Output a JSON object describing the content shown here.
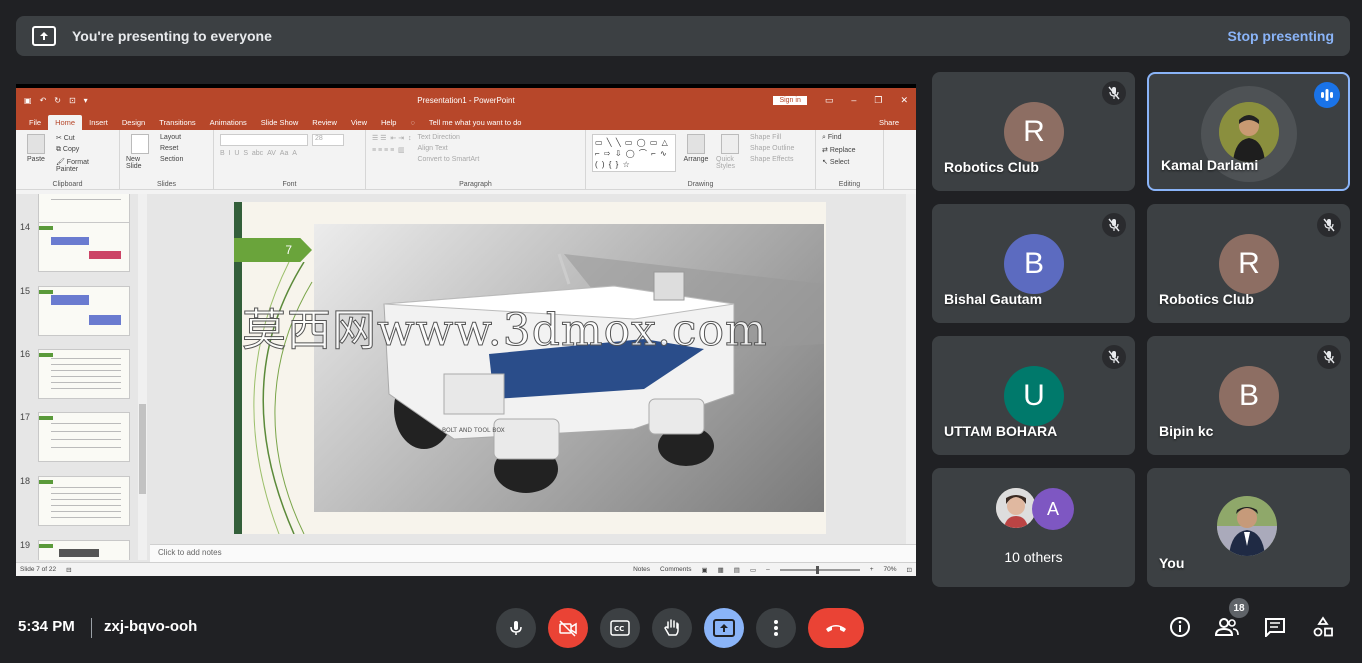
{
  "banner": {
    "title": "You're presenting to everyone",
    "stop": "Stop presenting"
  },
  "ppt": {
    "window_title": "Presentation1 - PowerPoint",
    "sign_in": "Sign in",
    "tabs": [
      "File",
      "Home",
      "Insert",
      "Design",
      "Transitions",
      "Animations",
      "Slide Show",
      "Review",
      "View",
      "Help"
    ],
    "tell_me": "Tell me what you want to do",
    "share": "Share",
    "clipboard": {
      "paste": "Paste",
      "cut": "Cut",
      "copy": "Copy",
      "format_painter": "Format Painter",
      "label": "Clipboard"
    },
    "slides": {
      "new_slide": "New Slide",
      "layout": "Layout",
      "reset": "Reset",
      "section": "Section",
      "label": "Slides"
    },
    "font": {
      "size": "28",
      "label": "Font"
    },
    "paragraph": {
      "text_direction": "Text Direction",
      "align_text": "Align Text",
      "smartart": "Convert to SmartArt",
      "label": "Paragraph"
    },
    "drawing": {
      "arrange": "Arrange",
      "quick_styles": "Quick Styles",
      "shape_fill": "Shape Fill",
      "shape_outline": "Shape Outline",
      "shape_effects": "Shape Effects",
      "label": "Drawing"
    },
    "editing": {
      "find": "Find",
      "replace": "Replace",
      "select": "Select",
      "label": "Editing"
    },
    "thumbnails": [
      "14",
      "15",
      "16",
      "17",
      "18",
      "19"
    ],
    "slide_number": "7",
    "slide_caption": "BOLT AND TOOL BOX",
    "watermark": "莫西网www.3dmox.com",
    "notes_placeholder": "Click to add notes",
    "status": {
      "slide": "Slide 7 of 22",
      "notes": "Notes",
      "comments": "Comments",
      "zoom": "70%"
    }
  },
  "participants": [
    {
      "name": "Robotics Club",
      "initial": "R",
      "color": "#8d6e63",
      "muted": true
    },
    {
      "name": "Kamal Darlami",
      "initial": "",
      "color": "#6b7a3a",
      "speaking": true
    },
    {
      "name": "Bishal Gautam",
      "initial": "B",
      "color": "#5c6bc0",
      "muted": true
    },
    {
      "name": "Robotics Club",
      "initial": "R",
      "color": "#8d6e63",
      "muted": true
    },
    {
      "name": "UTTAM BOHARA",
      "initial": "U",
      "color": "#00796b",
      "muted": true
    },
    {
      "name": "Bipin kc",
      "initial": "B",
      "color": "#8d6e63",
      "muted": true
    }
  ],
  "others": {
    "label": "10 others",
    "initial": "A",
    "color": "#7e57c2"
  },
  "you": {
    "label": "You"
  },
  "bottom": {
    "time": "5:34 PM",
    "code": "zxj-bqvo-ooh",
    "people_count": "18"
  }
}
